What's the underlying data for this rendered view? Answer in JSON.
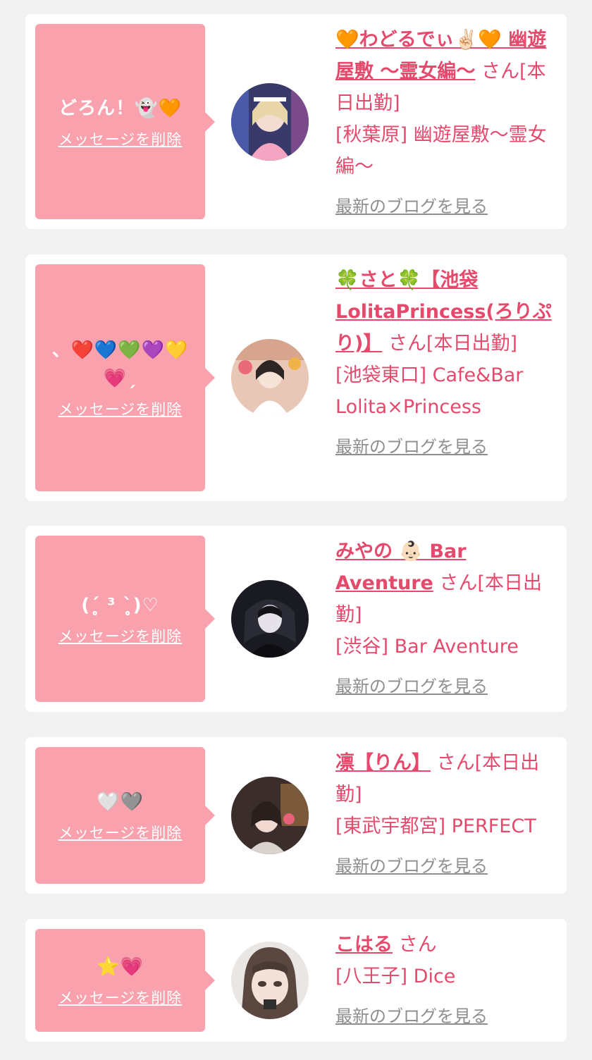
{
  "delete_label": "メッセージを削除",
  "blog_label": "最新のブログを見る",
  "cards": [
    {
      "message": "どろん！👻🧡",
      "name": "🧡わどるでぃ✌🏻🧡 幽遊屋敷 〜霊女編〜",
      "suffix": "さん[本日出勤]",
      "shop": "[秋葉原] 幽遊屋敷〜霊女編〜"
    },
    {
      "message": "、❤️💙💚💜💛💗ˏ",
      "name": "🍀さと🍀【池袋LolitaPrincess(ろりぷり)】",
      "suffix": "さん[本日出勤]",
      "shop": "[池袋東口] Cafe&Bar Lolita×Princess"
    },
    {
      "message": "(ˊ̥̥̥̥̥ ³ ˋ̥̥̥̥̥)♡",
      "name": "みやの 👶🏻 Bar Aventure",
      "suffix": "さん[本日出勤]",
      "shop": "[渋谷] Bar Aventure"
    },
    {
      "message": "🤍🩶",
      "name": "凛【りん】",
      "suffix": "さん[本日出勤]",
      "shop": "[東武宇都宮] PERFECT"
    },
    {
      "message": "⭐️💗",
      "name": "こはる",
      "suffix": "さん",
      "shop": "[八王子] Dice"
    }
  ],
  "colors": {
    "bubble": "#f9a1ac",
    "accent": "#e54a6c",
    "muted": "#8e8e8e",
    "background": "#f2f2f2"
  }
}
